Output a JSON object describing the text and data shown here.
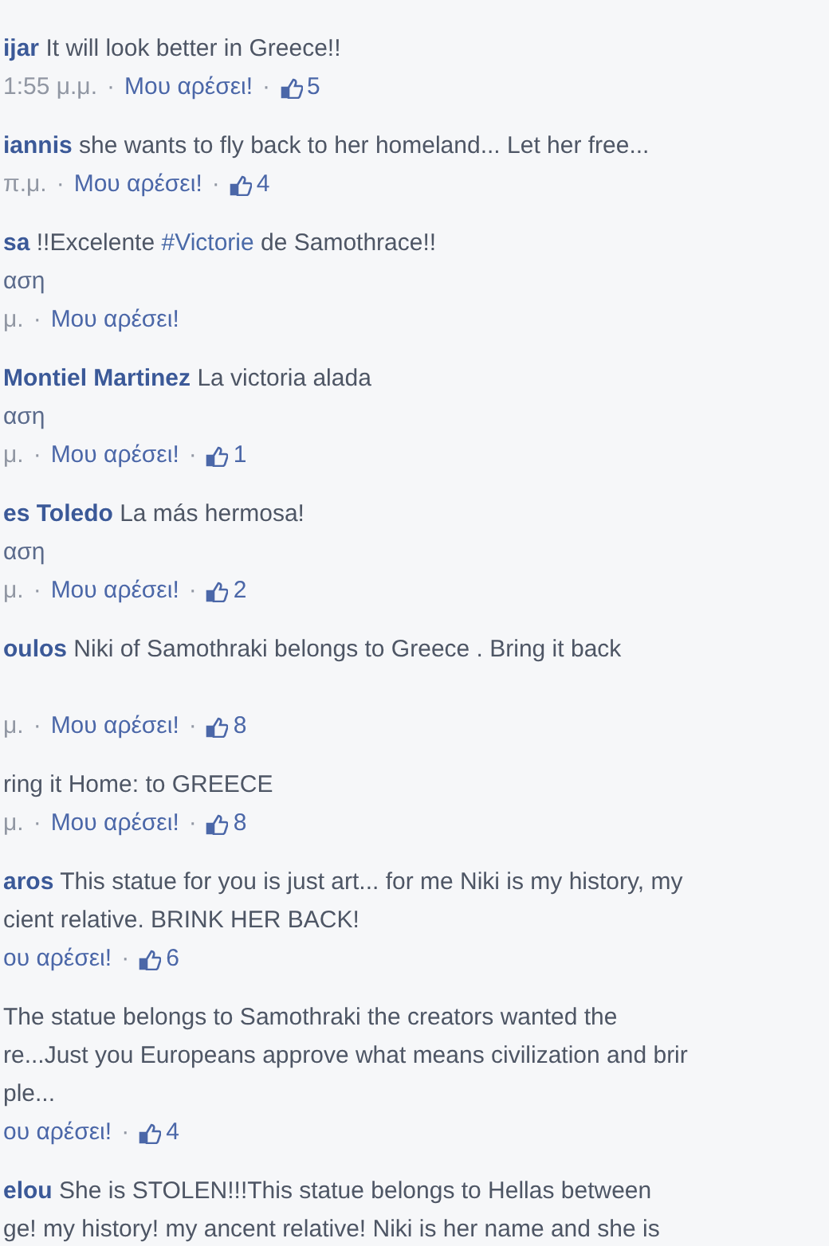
{
  "comments": [
    {
      "author": "ijar",
      "lines": [
        "It will look better in Greece!!"
      ],
      "meta": [
        {
          "kind": "time",
          "text": "1:55 μ.μ."
        },
        {
          "kind": "sep",
          "text": "·"
        },
        {
          "kind": "like",
          "text": "Μου αρέσει!"
        },
        {
          "kind": "sep",
          "text": "·"
        },
        {
          "kind": "count",
          "text": "5"
        }
      ]
    },
    {
      "author": "iannis",
      "lines": [
        "she wants to fly back to her homeland... Let her free..."
      ],
      "meta": [
        {
          "kind": "time",
          "text": "π.μ."
        },
        {
          "kind": "sep",
          "text": "·"
        },
        {
          "kind": "like",
          "text": "Μου αρέσει!"
        },
        {
          "kind": "sep",
          "text": "·"
        },
        {
          "kind": "count",
          "text": "4"
        }
      ]
    },
    {
      "author": "sa",
      "lines": [
        [
          {
            "kind": "plain",
            "text": "!!Excelente "
          },
          {
            "kind": "hashtag",
            "text": "#Victorie"
          },
          {
            "kind": "plain",
            "text": " de Samothrace!!"
          }
        ]
      ],
      "translate": "αση",
      "meta": [
        {
          "kind": "time",
          "text": "μ."
        },
        {
          "kind": "sep",
          "text": "·"
        },
        {
          "kind": "like",
          "text": "Μου αρέσει!"
        }
      ]
    },
    {
      "author": "Montiel Martinez",
      "lines": [
        "La victoria alada"
      ],
      "translate": "αση",
      "meta": [
        {
          "kind": "time",
          "text": "μ."
        },
        {
          "kind": "sep",
          "text": "·"
        },
        {
          "kind": "like",
          "text": "Μου αρέσει!"
        },
        {
          "kind": "sep",
          "text": "·"
        },
        {
          "kind": "count",
          "text": "1"
        }
      ]
    },
    {
      "author": "es Toledo",
      "lines": [
        "La más hermosa!"
      ],
      "translate": "αση",
      "meta": [
        {
          "kind": "time",
          "text": "μ."
        },
        {
          "kind": "sep",
          "text": "·"
        },
        {
          "kind": "like",
          "text": "Μου αρέσει!"
        },
        {
          "kind": "sep",
          "text": "·"
        },
        {
          "kind": "count",
          "text": "2"
        }
      ]
    },
    {
      "author": "oulos",
      "lines": [
        "Niki of Samothraki belongs to Greece . Bring it back"
      ],
      "blank_line": true,
      "meta": [
        {
          "kind": "time",
          "text": "μ."
        },
        {
          "kind": "sep",
          "text": "·"
        },
        {
          "kind": "like",
          "text": "Μου αρέσει!"
        },
        {
          "kind": "sep",
          "text": "·"
        },
        {
          "kind": "count",
          "text": "8"
        }
      ]
    },
    {
      "lines": [
        "ring it Home: to GREECE"
      ],
      "meta": [
        {
          "kind": "time",
          "text": "μ."
        },
        {
          "kind": "sep",
          "text": "·"
        },
        {
          "kind": "like",
          "text": "Μου αρέσει!"
        },
        {
          "kind": "sep",
          "text": "·"
        },
        {
          "kind": "count",
          "text": "8"
        }
      ]
    },
    {
      "author": "aros",
      "lines": [
        "This statue for you is just art... for me Niki is my history, my",
        "cient relative. BRINK HER BACK!"
      ],
      "meta": [
        {
          "kind": "like",
          "text": "ου αρέσει!"
        },
        {
          "kind": "sep",
          "text": "·"
        },
        {
          "kind": "count",
          "text": "6"
        }
      ]
    },
    {
      "lines": [
        "The statue belongs to Samothraki the creators wanted the",
        "re...Just you Europeans approve what means civilization and brir",
        "ple..."
      ],
      "meta": [
        {
          "kind": "like",
          "text": "ου αρέσει!"
        },
        {
          "kind": "sep",
          "text": "·"
        },
        {
          "kind": "count",
          "text": "4"
        }
      ]
    },
    {
      "author": "elou",
      "lines": [
        "She is STOLEN!!!This statue belongs to Hellas between",
        "ge! my history! my ancent relative! Niki is her name and she is"
      ]
    }
  ]
}
